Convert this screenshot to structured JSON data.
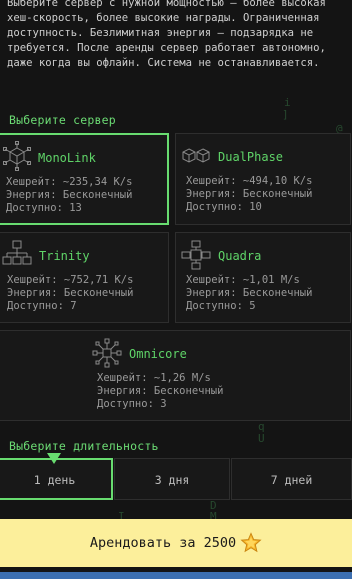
{
  "intro_text": "Выберите сервер с нужной мощностью — более высокая хеш-скорость, более высокие награды. Ограниченная доступность. Безлимитная энергия — подзарядка не требуется. После аренды сервер работает автономно, даже когда вы офлайн. Система не останавливается.",
  "server_section": {
    "label": "Выберите сервер",
    "selected": "MonoLink",
    "servers": [
      {
        "name": "MonoLink",
        "icon": "cube-network-icon",
        "hashrate": "Хешрейт: ~235,34 K/s",
        "energy": "Энергия: Бесконечный",
        "available": "Доступно: 13"
      },
      {
        "name": "DualPhase",
        "icon": "double-cube-icon",
        "hashrate": "Хешрейт: ~494,10 K/s",
        "energy": "Энергия: Бесконечный",
        "available": "Доступно: 10"
      },
      {
        "name": "Trinity",
        "icon": "tri-node-icon",
        "hashrate": "Хешрейт: ~752,71 K/s",
        "energy": "Энергия: Бесконечный",
        "available": "Доступно: 7"
      },
      {
        "name": "Quadra",
        "icon": "quad-node-icon",
        "hashrate": "Хешрейт: ~1,01 M/s",
        "energy": "Энергия: Бесконечный",
        "available": "Доступно: 5"
      },
      {
        "name": "Omnicore",
        "icon": "omni-node-icon",
        "hashrate": "Хешрейт: ~1,26 M/s",
        "energy": "Энергия: Бесконечный",
        "available": "Доступно: 3"
      }
    ]
  },
  "duration_section": {
    "label": "Выберите длительность",
    "options": [
      "1 день",
      "3 дня",
      "7 дней"
    ],
    "selected": "1 день"
  },
  "rent_button": {
    "label": "Арендовать за 2500",
    "icon": "star-coin-icon"
  },
  "colors": {
    "accent": "#68dc70",
    "button_bg": "#fcef9b",
    "background": "#141414"
  }
}
